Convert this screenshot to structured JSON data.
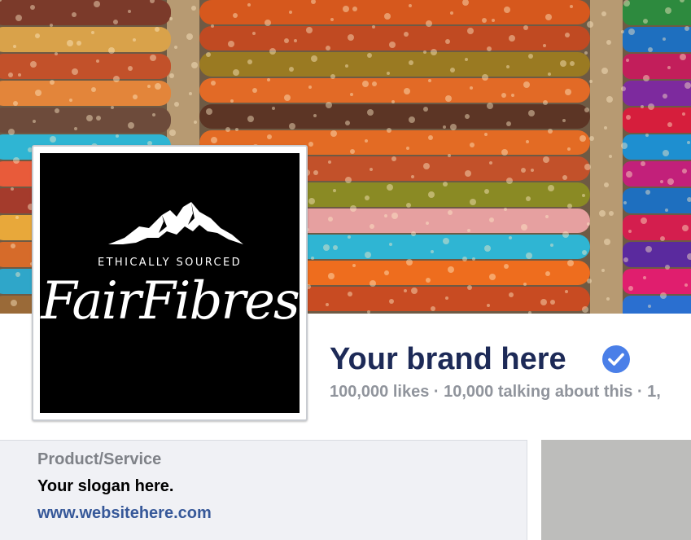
{
  "cover": {
    "description_icon": "folded-fabric-cover-photo",
    "colors": [
      "#8a3f1e",
      "#d6581d",
      "#e36b24",
      "#c2512a",
      "#9a7a22",
      "#2fb5d3",
      "#e64a1c",
      "#5c3525",
      "#b03024",
      "#1e6fbf",
      "#c21e5b",
      "#7d2a9e"
    ]
  },
  "profile": {
    "tagline": "ETHICALLY SOURCED",
    "wordmark": "FairFibres",
    "icon": "mountain-icon"
  },
  "page": {
    "name": "Your brand here",
    "verified_icon": "verified-check-icon",
    "verified_color": "#4a7fe8",
    "stats": "100,000 likes · 10,000 talking about this · 1,"
  },
  "about": {
    "category": "Product/Service",
    "slogan": "Your slogan here.",
    "website": "www.websitehere.com"
  },
  "colors": {
    "brand_text": "#1d2a57",
    "muted_text": "#90949c",
    "link": "#365899",
    "about_bg": "#f0f1f5"
  }
}
